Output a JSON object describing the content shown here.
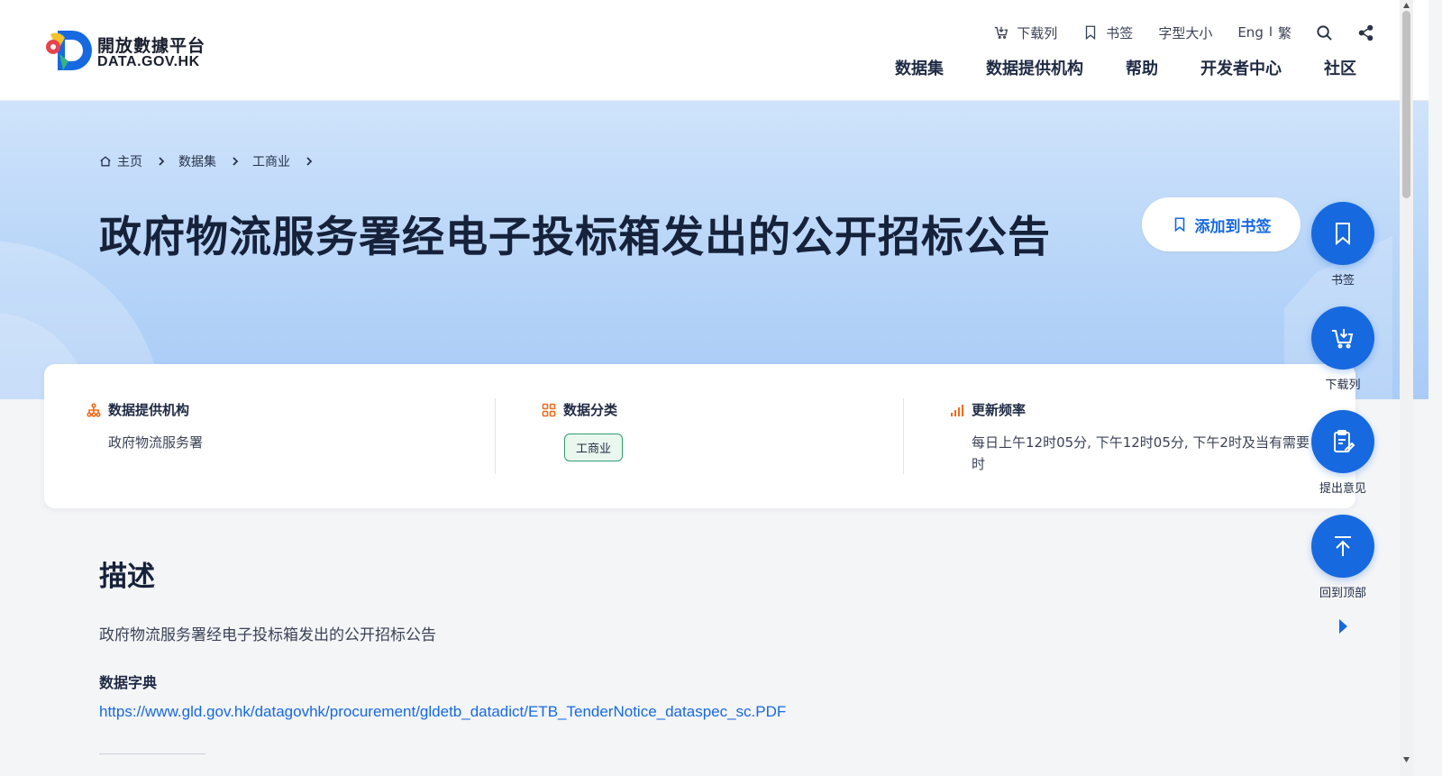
{
  "header": {
    "logo": {
      "cn": "開放數據平台",
      "en": "DATA.GOV.HK"
    },
    "utility": {
      "download_list": "下载列",
      "bookmark": "书签",
      "font_size": "字型大小",
      "lang_en": "Eng",
      "lang_sep": "I",
      "lang_tc": "繁"
    },
    "nav": [
      "数据集",
      "数据提供机构",
      "帮助",
      "开发者中心",
      "社区"
    ]
  },
  "breadcrumb": [
    "主页",
    "数据集",
    "工商业"
  ],
  "page_title": "政府物流服务署经电子投标箱发出的公开招标公告",
  "bookmark_button": "添加到书签",
  "info": {
    "provider_label": "数据提供机构",
    "provider_value": "政府物流服务署",
    "category_label": "数据分类",
    "category_tag": "工商业",
    "frequency_label": "更新频率",
    "frequency_value": "每日上午12时05分, 下午12时05分, 下午2时及当有需要时"
  },
  "description": {
    "heading": "描述",
    "text": "政府物流服务署经电子投标箱发出的公开招标公告",
    "dictionary_label": "数据字典",
    "dictionary_link": "https://www.gld.gov.hk/datagovhk/procurement/gldetb_datadict/ETB_TenderNotice_dataspec_sc.PDF"
  },
  "floating_actions": {
    "bookmark": "书签",
    "download_list": "下载列",
    "feedback": "提出意见",
    "back_to_top": "回到顶部"
  },
  "colors": {
    "primary": "#1769e0",
    "hero_bg": "#b6d4f8",
    "tag_border": "#2f9e6f",
    "accent_orange": "#f26b1d"
  }
}
